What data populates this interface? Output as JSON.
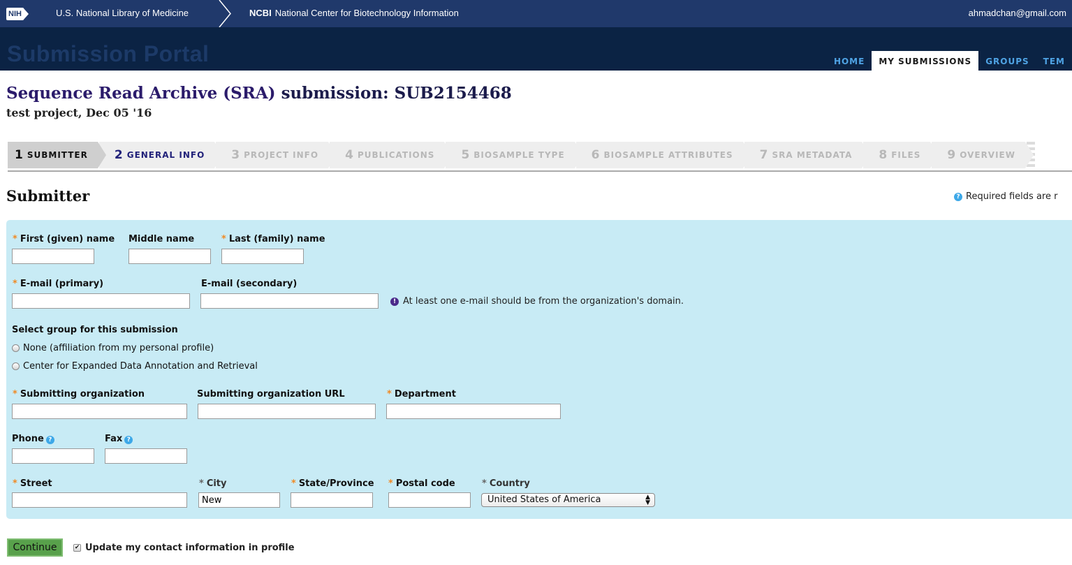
{
  "topbar": {
    "nih_logo": "NIH",
    "nlm_link": "U.S. National Library of Medicine",
    "ncbi_short": "NCBI",
    "ncbi_full": "National Center for Biotechnology Information",
    "user_email": "ahmadchan@gmail.com"
  },
  "portal": {
    "title": "Submission Portal",
    "nav": [
      "HOME",
      "MY SUBMISSIONS",
      "GROUPS",
      "TEM"
    ],
    "active_nav": "MY SUBMISSIONS"
  },
  "page": {
    "title_link": "Sequence Read Archive (SRA)",
    "title_rest": " submission: SUB2154468",
    "subtitle": "test project, Dec 05 '16"
  },
  "steps": [
    {
      "num": "1",
      "label": "SUBMITTER",
      "state": "current"
    },
    {
      "num": "2",
      "label": "GENERAL INFO",
      "state": "next"
    },
    {
      "num": "3",
      "label": "PROJECT INFO",
      "state": "disabled"
    },
    {
      "num": "4",
      "label": "PUBLICATIONS",
      "state": "disabled"
    },
    {
      "num": "5",
      "label": "BIOSAMPLE TYPE",
      "state": "disabled"
    },
    {
      "num": "6",
      "label": "BIOSAMPLE ATTRIBUTES",
      "state": "disabled"
    },
    {
      "num": "7",
      "label": "SRA METADATA",
      "state": "disabled"
    },
    {
      "num": "8",
      "label": "FILES",
      "state": "disabled"
    },
    {
      "num": "9",
      "label": "OVERVIEW",
      "state": "disabled"
    }
  ],
  "section": {
    "title": "Submitter",
    "required_note": "Required fields are r"
  },
  "form": {
    "first_name": {
      "label": "First (given) name",
      "value": ""
    },
    "middle_name": {
      "label": "Middle name",
      "value": ""
    },
    "last_name": {
      "label": "Last (family) name",
      "value": ""
    },
    "email_primary": {
      "label": "E-mail (primary)",
      "value": ""
    },
    "email_secondary": {
      "label": "E-mail (secondary)",
      "value": ""
    },
    "email_note": "At least one e-mail should be from the organization's domain.",
    "group_label": "Select group for this submission",
    "group_options": [
      "None (affiliation from my personal profile)",
      "Center for Expanded Data Annotation and Retrieval"
    ],
    "org": {
      "label": "Submitting organization",
      "value": ""
    },
    "org_url": {
      "label": "Submitting organization URL",
      "value": ""
    },
    "department": {
      "label": "Department",
      "value": ""
    },
    "phone": {
      "label": "Phone",
      "value": ""
    },
    "fax": {
      "label": "Fax",
      "value": ""
    },
    "street": {
      "label": "Street",
      "value": ""
    },
    "city": {
      "label": "City",
      "value": "New"
    },
    "state": {
      "label": "State/Province",
      "value": ""
    },
    "postal": {
      "label": "Postal code",
      "value": ""
    },
    "country": {
      "label": "Country",
      "value": "United States of America"
    }
  },
  "footer": {
    "continue_label": "Continue",
    "update_label": "Update my contact information in profile",
    "update_checked": true
  },
  "colors": {
    "topbar": "#20396b",
    "portal_header": "#0b2344",
    "panel": "#c8ebf5",
    "required_star": "#f08a24",
    "continue": "#58a14b"
  }
}
